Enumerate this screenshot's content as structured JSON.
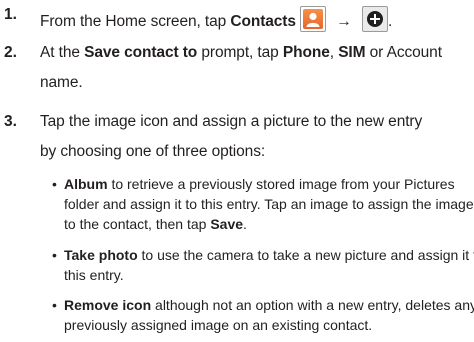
{
  "steps": [
    {
      "number": "1.",
      "text_before": "From the Home screen, tap ",
      "bold1": "Contacts",
      "arrow": "→",
      "text_after": ".",
      "icons": [
        "contacts-icon",
        "add-icon"
      ]
    },
    {
      "number": "2.",
      "line1_text1": "At the ",
      "line1_bold1": "Save contact to",
      "line1_text2": " prompt, tap ",
      "line1_bold2": "Phone",
      "line1_text3": ", ",
      "line1_bold3": "SIM",
      "line1_text4": " or Account",
      "line2": "name."
    },
    {
      "number": "3.",
      "line1": "Tap the image icon and assign a picture to the new entry",
      "line2": "by choosing one of three options:",
      "bullets": [
        {
          "bold": "Album",
          "line1": " to retrieve a previously stored image from your Pictures",
          "line2": "folder and assign it to this entry. Tap an image to assign the image",
          "line3_text": "to the contact, then tap ",
          "line3_bold": "Save",
          "line3_end": "."
        },
        {
          "bold": "Take photo",
          "line1": " to use the camera to take a new picture and assign it to",
          "line2": "this entry."
        },
        {
          "bold": "Remove icon",
          "line1": " although not an option with a new entry, deletes any",
          "line2": "previously assigned image on an existing contact."
        }
      ]
    }
  ],
  "colors": {
    "text": "#231f20",
    "contacts_icon": "#ef7a3a",
    "add_icon_bg": "#eaeaea"
  }
}
